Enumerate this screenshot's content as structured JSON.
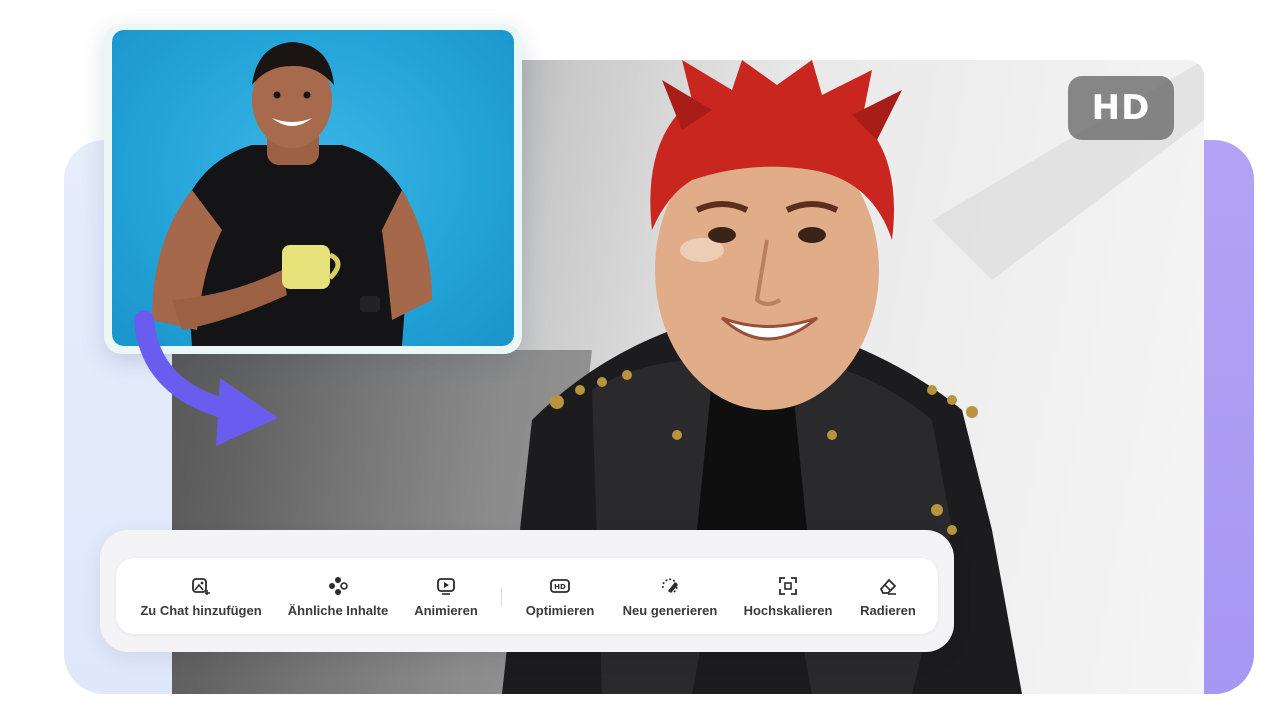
{
  "badge": {
    "label": "HD"
  },
  "toolbar": {
    "items": [
      {
        "label": "Zu Chat hinzufügen",
        "icon": "add-to-chat-icon"
      },
      {
        "label": "Ähnliche Inhalte",
        "icon": "similar-content-icon"
      },
      {
        "label": "Animieren",
        "icon": "animate-icon"
      },
      {
        "label": "Optimieren",
        "icon": "hd-optimize-icon"
      },
      {
        "label": "Neu generieren",
        "icon": "regenerate-icon"
      },
      {
        "label": "Hochskalieren",
        "icon": "upscale-icon"
      },
      {
        "label": "Radieren",
        "icon": "eraser-icon"
      }
    ]
  },
  "colors": {
    "accent_purple": "#6b5cf0",
    "right_panel": "#a697f3",
    "left_panel": "#e3eafb",
    "source_bg": "#22a3d8",
    "hair_red": "#c8261f"
  }
}
